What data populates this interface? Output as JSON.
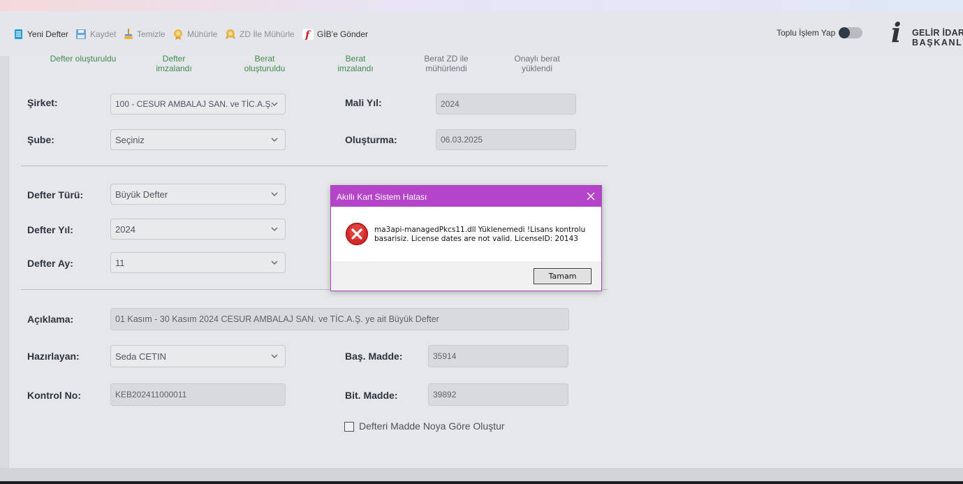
{
  "toolbar": {
    "new_book": "Yeni Defter",
    "save": "Kaydet",
    "clear": "Temizle",
    "seal": "Mühürle",
    "zd_seal": "ZD İle Mühürle",
    "send_gib": "GİB'e Gönder",
    "bulk_label": "Toplu İşlem Yap",
    "logo_line1": "GELİR İDARE",
    "logo_line2": "BAŞKANLI"
  },
  "steps": [
    "Defter oluşturuldu",
    "Defter\nimzalandı",
    "Berat\noluşturuldu",
    "Berat\nimzalandı",
    "Berat ZD ile\nmühürlendi",
    "Onaylı berat\nyüklendi"
  ],
  "form": {
    "company_label": "Şirket:",
    "company_value": "100 - CESUR AMBALAJ SAN. ve TİC.A.Ş.",
    "fiscal_year_label": "Mali Yıl:",
    "fiscal_year_value": "2024",
    "branch_label": "Şube:",
    "branch_value": "Seçiniz",
    "created_label": "Oluşturma:",
    "created_value": "06.03.2025",
    "book_type_label": "Defter Türü:",
    "book_type_value": "Büyük Defter",
    "book_year_label": "Defter Yıl:",
    "book_year_value": "2024",
    "book_month_label": "Defter Ay:",
    "book_month_value": "11",
    "desc_label": "Açıklama:",
    "desc_value": "01 Kasım - 30 Kasım 2024 CESUR AMBALAJ SAN. ve TİC.A.Ş. ye ait Büyük Defter",
    "prepared_label": "Hazırlayan:",
    "prepared_value": "Seda CETIN",
    "start_item_label": "Baş. Madde:",
    "start_item_value": "35914",
    "control_label": "Kontrol No:",
    "control_value": "KEB202411000011",
    "end_item_label": "Bit. Madde:",
    "end_item_value": "39892",
    "checkbox_label": "Defteri Madde Noya Göre Oluştur"
  },
  "dialog": {
    "title": "Akıllı Kart Sistem Hatası",
    "message": "ma3api-managedPkcs11.dll Yüklenemedi !Lisans kontrolu basarisiz. License dates are not valid. LicenseID: 20143",
    "ok": "Tamam"
  },
  "colors": {
    "dialog_title": "#b545c8",
    "step_done": "#3f8a55",
    "error_red": "#d42a2a"
  }
}
